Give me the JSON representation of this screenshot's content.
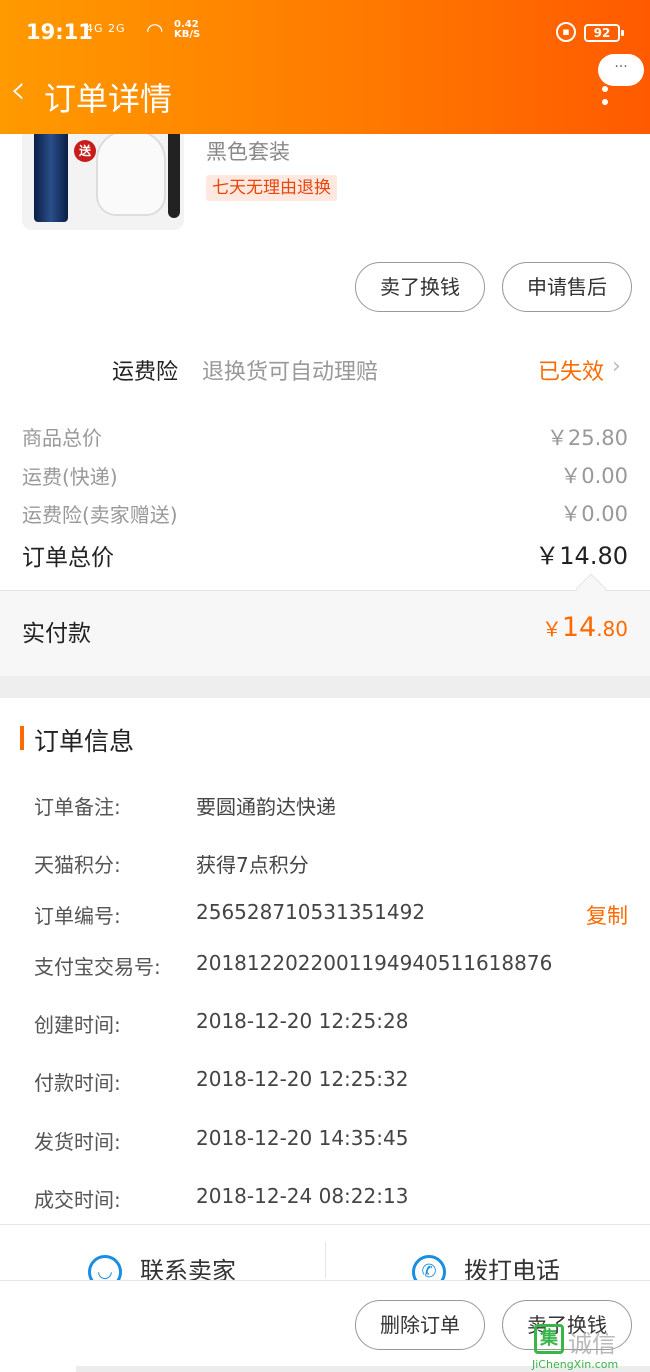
{
  "status_bar": {
    "time": "19:11",
    "signal": "4G 2G",
    "speed": "0.42",
    "speed_unit": "KB/S",
    "battery": "92"
  },
  "header": {
    "back_icon": "chevron-left-icon",
    "title": "订单详情",
    "more_bubble": "···"
  },
  "product": {
    "gift_badge": "送",
    "variant": "黑色套装",
    "return_policy": "七天无理由退换"
  },
  "item_actions": {
    "sell": "卖了换钱",
    "after_sales": "申请售后"
  },
  "insurance": {
    "label": "运费险",
    "description": "退换货可自动理赔",
    "status": "已失效"
  },
  "prices": [
    {
      "label": "商品总价",
      "value": "￥25.80"
    },
    {
      "label": "运费(快递)",
      "value": "￥0.00"
    },
    {
      "label": "运费险(卖家赠送)",
      "value": "￥0.00"
    }
  ],
  "order_total": {
    "label": "订单总价",
    "value": "￥14.80"
  },
  "paid": {
    "label": "实付款",
    "currency": "￥",
    "integer": "14",
    "decimal": ".80"
  },
  "order_info": {
    "title": "订单信息",
    "rows": [
      {
        "label": "订单备注:",
        "value": "要圆通韵达快递"
      },
      {
        "label": "天猫积分:",
        "value": "获得7点积分"
      },
      {
        "label": "订单编号:",
        "value": "256528710531351492"
      },
      {
        "label": "支付宝交易号:",
        "value": "2018122022001194940511618876"
      },
      {
        "label": "创建时间:",
        "value": "2018-12-20 12:25:28"
      },
      {
        "label": "付款时间:",
        "value": "2018-12-20 12:25:32"
      },
      {
        "label": "发货时间:",
        "value": "2018-12-20 14:35:45"
      },
      {
        "label": "成交时间:",
        "value": "2018-12-24 08:22:13"
      }
    ],
    "copy": "复制"
  },
  "contact": {
    "seller": "联系卖家",
    "call": "拨打电话"
  },
  "footer": {
    "delete": "删除订单",
    "sell": "卖了换钱"
  },
  "watermark": {
    "logo_char": "集",
    "cn": "诚信",
    "en": "JiChengXin.com"
  }
}
